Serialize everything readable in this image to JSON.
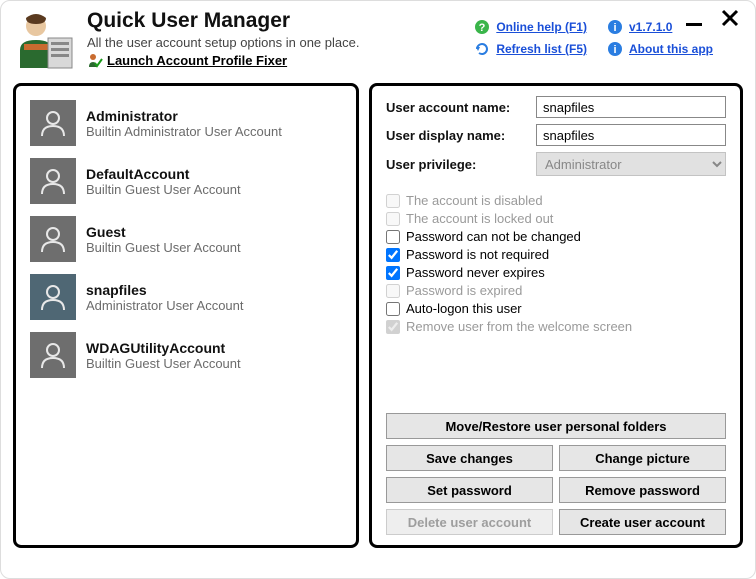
{
  "app": {
    "title": "Quick User Manager",
    "subtitle": "All the user account setup options in one place.",
    "launch_fixer": "Launch Account Profile Fixer"
  },
  "links": {
    "help": "Online help (F1)",
    "version": "v1.7.1.0",
    "refresh": "Refresh list (F5)",
    "about": "About this app"
  },
  "users": [
    {
      "name": "Administrator",
      "desc": "Builtin Administrator User Account",
      "selected": false
    },
    {
      "name": "DefaultAccount",
      "desc": "Builtin Guest User Account",
      "selected": false
    },
    {
      "name": "Guest",
      "desc": "Builtin Guest User Account",
      "selected": false
    },
    {
      "name": "snapfiles",
      "desc": "Administrator User Account",
      "selected": true
    },
    {
      "name": "WDAGUtilityAccount",
      "desc": "Builtin Guest User Account",
      "selected": false
    }
  ],
  "form": {
    "account_name_label": "User account name:",
    "account_name_value": "snapfiles",
    "display_name_label": "User display name:",
    "display_name_value": "snapfiles",
    "privilege_label": "User privilege:",
    "privilege_value": "Administrator"
  },
  "checks": {
    "disabled": "The account is disabled",
    "locked": "The account is locked out",
    "pw_nochg": "Password can not be changed",
    "pw_notreq": "Password is not required",
    "pw_neverexp": "Password never expires",
    "pw_expired": "Password is expired",
    "autologon": "Auto-logon this user",
    "remove_welcome": "Remove user from the welcome screen"
  },
  "buttons": {
    "move_restore": "Move/Restore user personal folders",
    "save": "Save changes",
    "change_pic": "Change picture",
    "set_pw": "Set password",
    "remove_pw": "Remove password",
    "delete": "Delete user account",
    "create": "Create user account"
  }
}
